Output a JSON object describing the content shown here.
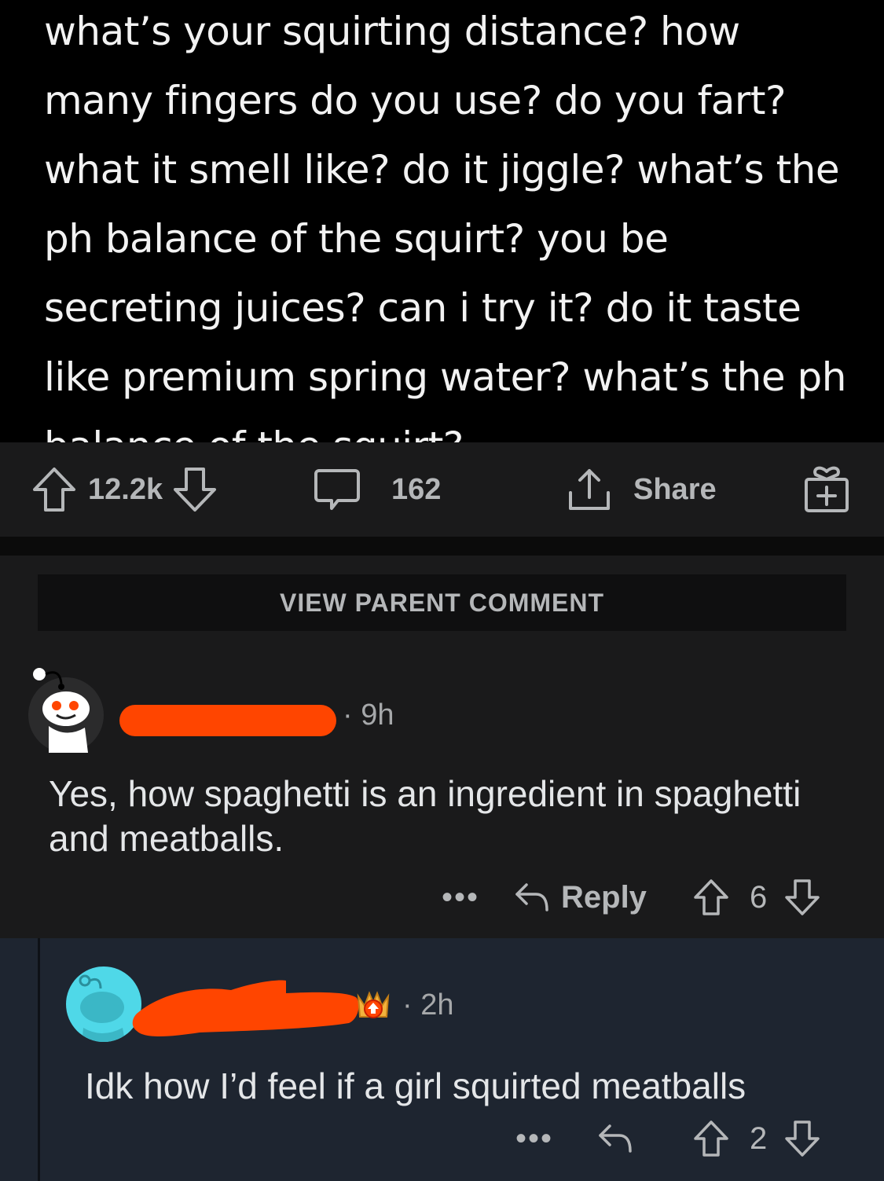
{
  "post": {
    "image_text": "what’s your squirting distance? how many fingers do you use? do you fart? what it smell like? do it jiggle? what’s the ph balance of the squirt? you be secreting juices? can i try it? do it taste like premium spring water? what’s the ph balance of the squirt?"
  },
  "action_bar": {
    "score": "12.2k",
    "comments": "162",
    "share_label": "Share",
    "icons": [
      "upvote-icon",
      "downvote-icon",
      "comment-icon",
      "share-icon",
      "award-icon"
    ]
  },
  "thread": {
    "view_parent_label": "VIEW PARENT COMMENT"
  },
  "comment1": {
    "meta": "· 9h",
    "body": "Yes, how spaghetti is an ingredient in spaghetti and meatballs.",
    "more": "•••",
    "reply_label": "Reply",
    "score": "6"
  },
  "comment2": {
    "meta": "· 2h",
    "body": "Idk how I’d feel if a girl squirted meatballs",
    "more": "•••",
    "score": "2"
  },
  "colors": {
    "redaction": "#ff4500",
    "background": "#1a1a1b",
    "reply_background": "#1e2530",
    "avatar2": "#4fd8e8"
  }
}
